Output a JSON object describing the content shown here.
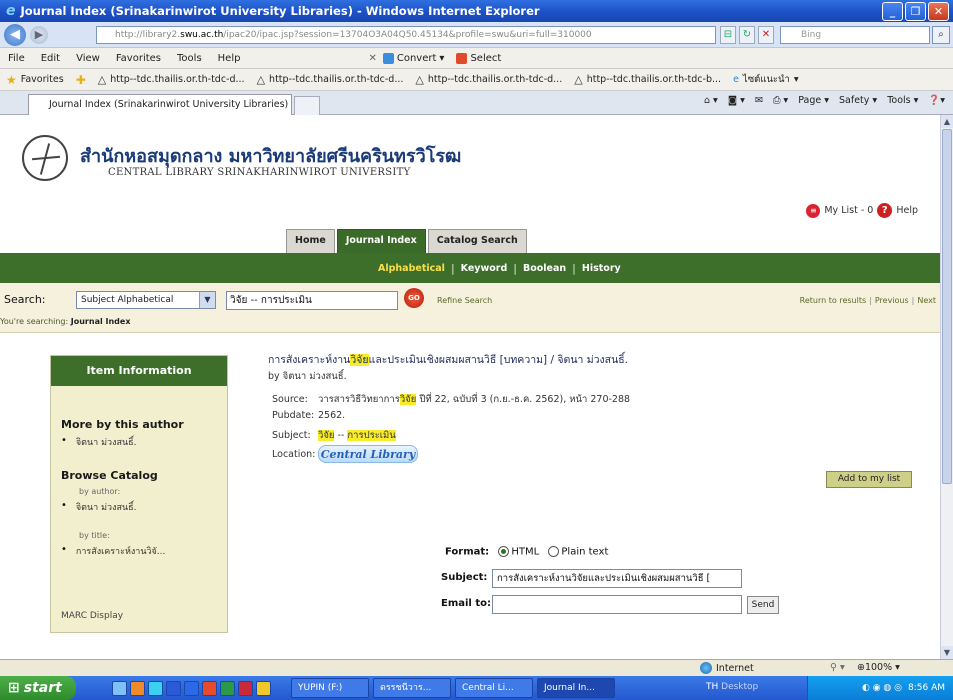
{
  "window": {
    "title": "Journal Index (Srinakarinwirot University Libraries) - Windows Internet Explorer"
  },
  "address_bar": {
    "url_prefix": "http://library2.",
    "url_domain": "swu.ac.th",
    "url_rest": "/ipac20/ipac.jsp?session=13704O3A04Q50.45134&profile=swu&uri=full=310000",
    "search_placeholder": "Bing"
  },
  "menu": {
    "items": [
      "File",
      "Edit",
      "View",
      "Favorites",
      "Tools",
      "Help"
    ],
    "convert_label": "Convert",
    "select_label": "Select"
  },
  "favorites": {
    "label": "Favorites",
    "links": [
      "http--tdc.thailis.or.th-tdc-d...",
      "http--tdc.thailis.or.th-tdc-d...",
      "http--tdc.thailis.or.th-tdc-d...",
      "http--tdc.thailis.or.th-tdc-b...",
      "ไซต์แนะนำ"
    ]
  },
  "tabs": {
    "active_tab": "Journal Index (Srinakarinwirot University Libraries)",
    "commands": [
      "Page",
      "Safety",
      "Tools"
    ]
  },
  "header": {
    "thai_name": "สำนักหอสมุดกลาง มหาวิทยาลัยศรีนครินทรวิโรฒ",
    "eng_name": "CENTRAL LIBRARY SRINAKHARINWIROT UNIVERSITY",
    "my_list": "My List - 0",
    "help": "Help"
  },
  "main_tabs": [
    "Home",
    "Journal Index",
    "Catalog Search"
  ],
  "sub_nav": [
    "Alphabetical",
    "Keyword",
    "Boolean",
    "History"
  ],
  "search": {
    "label": "Search:",
    "type_selected": "Subject Alphabetical",
    "query": "วิจัย -- การประเมิน",
    "go": "GO",
    "refine": "Refine Search",
    "return_link": "Return to results",
    "previous_link": "Previous",
    "next_link": "Next",
    "searching_prefix": "You're searching:",
    "searching_target": "Journal Index"
  },
  "sidebar": {
    "heading": "Item Information",
    "more_by_author": "More by this author",
    "author_item": "จิตนา ม่วงสนธิ์.",
    "browse_catalog": "Browse Catalog",
    "by_author": "by author:",
    "by_title": "by title:",
    "title_item": "การสังเคราะห์งานวิจั...",
    "marc": "MARC Display"
  },
  "item": {
    "title_before": "การสังเคราะห์งาน",
    "title_hl": "วิจัย",
    "title_after": "และประเมินเชิงผสมผสานวิธี [บทความ] / จิตนา ม่วงสนธิ์.",
    "by": "by จิตนา ม่วงสนธิ์.",
    "source_label": "Source:",
    "source_before": "วารสารวิธีวิทยาการ",
    "source_hl": "วิจัย",
    "source_after": " ปีที่ 22, ฉบับที่ 3 (ก.ย.-ธ.ค. 2562), หน้า 270-288",
    "pubdate_label": "Pubdate:",
    "pubdate": "2562.",
    "subject_label": "Subject:",
    "subject_a": "วิจัย",
    "subject_sep": " -- ",
    "subject_b": "การประเมิน",
    "location_label": "Location:",
    "location": "Central Library",
    "add_to_list": "Add to my list"
  },
  "email_form": {
    "format_label": "Format:",
    "format_html": "HTML",
    "format_plain": "Plain text",
    "subject_label": "Subject:",
    "subject_value": "การสังเคราะห์งานวิจัยและประเมินเชิงผสมผสานวิธี [",
    "email_label": "Email to:",
    "email_value": "",
    "send": "Send"
  },
  "status": {
    "zone": "Internet",
    "zoom": "100%"
  },
  "taskbar": {
    "start": "start",
    "tasks": [
      "YUPIN (F:)",
      "ดรรชนีวาร...",
      "Central Li...",
      "Journal In..."
    ],
    "lang": "TH",
    "desktop": "Desktop",
    "clock": "8:56 AM"
  }
}
